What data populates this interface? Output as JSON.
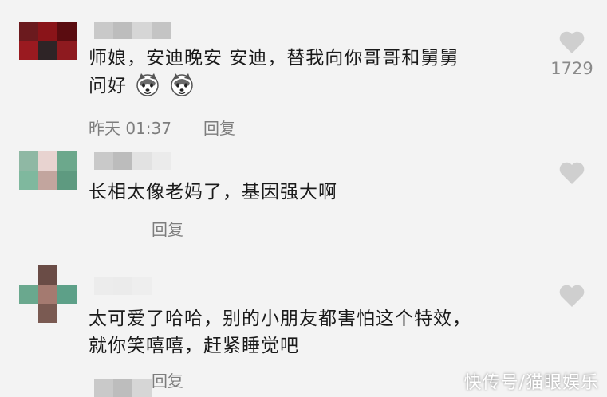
{
  "comments": [
    {
      "text_lines": [
        "师娘，安迪晚安 安迪，替我向你哥哥和舅舅",
        "问好"
      ],
      "emoji_names": [
        "husky-emoji",
        "husky-emoji"
      ],
      "date": "昨天 01:37",
      "reply_label": "回复",
      "like_count": "1729"
    },
    {
      "text_lines": [
        "长相太像老妈了，基因强大啊"
      ],
      "reply_label": "回复"
    },
    {
      "text_lines": [
        "太可爱了哈哈，别的小朋友都害怕这个特效，",
        "就你笑嘻嘻，赶紧睡觉吧"
      ],
      "reply_label": "回复"
    }
  ],
  "watermark": "快传号/猫眼娱乐",
  "colors": {
    "text": "#1a1a1a",
    "meta": "#7d7d7d",
    "heart": "#cfcfcf",
    "background": "#f3f3f3",
    "avatar1": [
      "#6b1a1e",
      "#8a1419",
      "#5a0c10",
      "#9a1a20",
      "#3a2a2c",
      "#8e1a1f"
    ],
    "avatar2": [
      "#8fb8a4",
      "#e8d3d0",
      "#6ca88c",
      "#7fb89e",
      "#c2a59e",
      "#5e9a80"
    ],
    "avatar3": [
      "#f3f3f3",
      "#6a4c46",
      "#f3f3f3",
      "#6aa88e",
      "#a47a70",
      "#5da088",
      "#f3f3f3",
      "#7a5a52",
      "#f3f3f3"
    ]
  }
}
